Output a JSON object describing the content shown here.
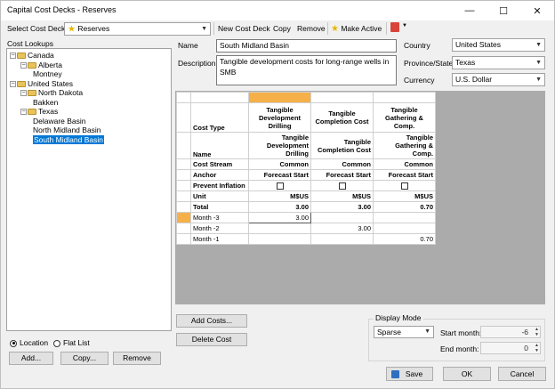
{
  "window": {
    "title": "Capital Cost Decks - Reserves"
  },
  "toolbar": {
    "select_label": "Select Cost Deck:",
    "selected_deck": "Reserves",
    "new": "New Cost Deck",
    "copy": "Copy",
    "remove": "Remove",
    "make_active": "Make Active"
  },
  "left": {
    "cost_lookups_label": "Cost Lookups",
    "tree": [
      {
        "label": "Canada",
        "level": 0,
        "expander": "−",
        "folder": true
      },
      {
        "label": "Alberta",
        "level": 1,
        "expander": "−",
        "folder": true
      },
      {
        "label": "Montney",
        "level": 2,
        "expander": "",
        "folder": false
      },
      {
        "label": "United States",
        "level": 0,
        "expander": "−",
        "folder": true
      },
      {
        "label": "North Dakota",
        "level": 1,
        "expander": "−",
        "folder": true
      },
      {
        "label": "Bakken",
        "level": 2,
        "expander": "",
        "folder": false
      },
      {
        "label": "Texas",
        "level": 1,
        "expander": "−",
        "folder": true
      },
      {
        "label": "Delaware Basin",
        "level": 2,
        "expander": "",
        "folder": false
      },
      {
        "label": "North Midland Basin",
        "level": 2,
        "expander": "",
        "folder": false
      },
      {
        "label": "South Midland Basin",
        "level": 2,
        "expander": "",
        "folder": false,
        "selected": true
      }
    ],
    "radio_location": "Location",
    "radio_flat": "Flat List",
    "add": "Add...",
    "copy": "Copy...",
    "remove": "Remove"
  },
  "form": {
    "name_label": "Name",
    "name_value": "South Midland Basin",
    "desc_label": "Description",
    "desc_value": "Tangible development costs for long-range wells in SMB",
    "country_label": "Country",
    "country_value": "United States",
    "province_label": "Province/State",
    "province_value": "Texas",
    "currency_label": "Currency",
    "currency_value": "U.S. Dollar"
  },
  "grid": {
    "columns": [
      {
        "cost_type": "Tangible Development Drilling",
        "name": "Tangible Development Drilling",
        "stream": "Common",
        "anchor": "Forecast Start",
        "unit": "M$US",
        "total": "3.00",
        "m3": "3.00",
        "m2": "",
        "m1": ""
      },
      {
        "cost_type": "Tangible Completion Cost",
        "name": "Tangible Completion Cost",
        "stream": "Common",
        "anchor": "Forecast Start",
        "unit": "M$US",
        "total": "3.00",
        "m3": "",
        "m2": "3.00",
        "m1": ""
      },
      {
        "cost_type": "Tangible Gathering & Comp.",
        "name": "Tangible Gathering & Comp.",
        "stream": "Common",
        "anchor": "Forecast Start",
        "unit": "M$US",
        "total": "0.70",
        "m3": "",
        "m2": "",
        "m1": "0.70"
      }
    ],
    "row_labels": {
      "cost_type": "Cost Type",
      "name": "Name",
      "stream": "Cost Stream",
      "anchor": "Anchor",
      "prevent": "Prevent Inflation",
      "unit": "Unit",
      "total": "Total",
      "m3": "Month -3",
      "m2": "Month -2",
      "m1": "Month -1"
    }
  },
  "bottom": {
    "add_costs": "Add Costs...",
    "delete_cost": "Delete Cost",
    "display_mode_label": "Display Mode",
    "display_mode_value": "Sparse",
    "start_month_label": "Start month:",
    "start_month_value": "-6",
    "end_month_label": "End month:",
    "end_month_value": "0",
    "save": "Save",
    "ok": "OK",
    "cancel": "Cancel"
  }
}
